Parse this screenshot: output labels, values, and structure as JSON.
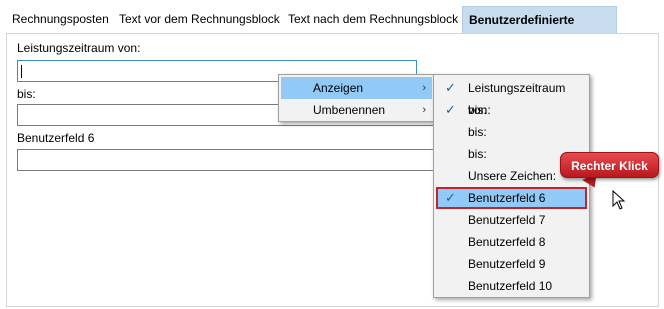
{
  "tabs": [
    {
      "label": "Rechnungsposten"
    },
    {
      "label": "Text vor dem Rechnungsblock"
    },
    {
      "label": "Text nach dem Rechnungsblock"
    },
    {
      "label": "Benutzerdefinierte Felder"
    }
  ],
  "fields": [
    {
      "label": "Leistungszeitraum von:",
      "value": ""
    },
    {
      "label": "bis:",
      "value": ""
    },
    {
      "label": "Benutzerfeld 6",
      "value": ""
    }
  ],
  "context_menu": {
    "items": [
      {
        "label": "Anzeigen",
        "arrow": "›"
      },
      {
        "label": "Umbenennen",
        "arrow": "›"
      }
    ]
  },
  "submenu": {
    "check_glyph": "✓",
    "items": [
      {
        "label": "Leistungszeitraum von:",
        "checked": true
      },
      {
        "label": "bis:",
        "checked": true
      },
      {
        "label": "bis:",
        "checked": false
      },
      {
        "label": "bis:",
        "checked": false
      },
      {
        "label": "Unsere Zeichen:",
        "checked": false
      },
      {
        "label": "Benutzerfeld 6",
        "checked": true
      },
      {
        "label": "Benutzerfeld 7",
        "checked": false
      },
      {
        "label": "Benutzerfeld 8",
        "checked": false
      },
      {
        "label": "Benutzerfeld 9",
        "checked": false
      },
      {
        "label": "Benutzerfeld 10",
        "checked": false
      }
    ]
  },
  "callout": {
    "text": "Rechter Klick"
  },
  "colors": {
    "accent_highlight": "#91c9f7",
    "callout_red": "#c0252b",
    "active_tab": "#c8dcf0"
  }
}
